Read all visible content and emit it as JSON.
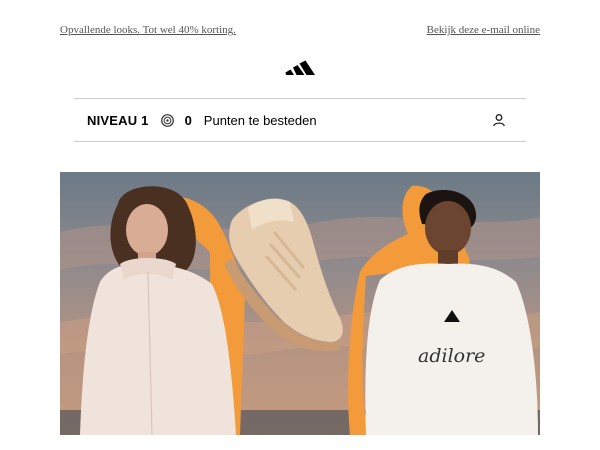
{
  "header": {
    "promo_link": "Opvallende looks. Tot wel 40% korting.",
    "view_online_link": "Bekijk deze e-mail online"
  },
  "brand": {
    "logo_icon": "adidas-logo-icon"
  },
  "loyalty_bar": {
    "level": "NIVEAU 1",
    "points_icon": "points-coin-icon",
    "points": "0",
    "points_label": "Punten te besteden",
    "account_icon": "user-icon"
  },
  "hero_banner": {
    "content": "product-photo",
    "shirt_script": "adilore",
    "colors": {
      "accent_outline": "#f39b3a",
      "sky_top": "#6b7a86",
      "sky_mid": "#9a8d89",
      "sky_low": "#c69b7e"
    }
  }
}
